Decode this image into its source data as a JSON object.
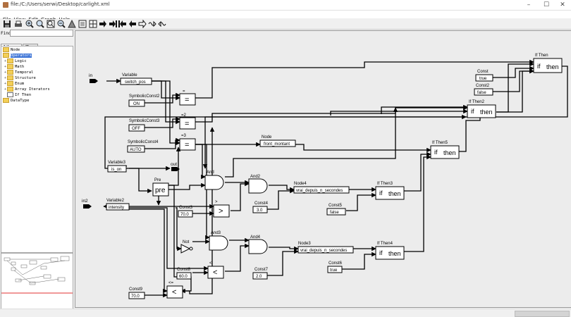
{
  "window": {
    "title": "file:/C:/Users/serwi/Desktop/carlight.xml",
    "minimize": "–",
    "maximize": "☐",
    "close": "✕"
  },
  "menu": [
    "File",
    "View",
    "Edit",
    "Graph",
    "Help"
  ],
  "toolbar": [
    "save-icon",
    "print-icon",
    "zoom-in-icon",
    "zoom-100-icon",
    "zoom-fit-icon",
    "zoom-out-icon",
    "layout-icon",
    "expand-icon",
    "triangle-icon",
    "arrow-right-icon",
    "arrow-right-bar-icon",
    "arrow-left-bar-icon",
    "arrow-left-icon",
    "arrow-outline-right-icon",
    "wave-right-icon",
    "wave-left-icon"
  ],
  "sidebar": {
    "find_label": "Find",
    "find_value": "",
    "tabs": [
      "Library",
      "Tree"
    ],
    "tree": [
      {
        "label": "Node",
        "indent": 0
      },
      {
        "label": "Operators",
        "indent": 0,
        "selected": true
      },
      {
        "label": "Logic",
        "indent": 1
      },
      {
        "label": "Math",
        "indent": 1
      },
      {
        "label": "Temporal",
        "indent": 1
      },
      {
        "label": "Structure",
        "indent": 1
      },
      {
        "label": "Enum",
        "indent": 1
      },
      {
        "label": "Array Iterators",
        "indent": 1
      },
      {
        "label": "If Then",
        "indent": 1
      },
      {
        "label": "DataType",
        "indent": 0
      }
    ]
  },
  "diagram": {
    "inputs": [
      "in",
      "in2"
    ],
    "outputs": [
      "out"
    ],
    "variables": [
      {
        "title": "Variable",
        "value": "switch_pos"
      },
      {
        "title": "Variable3",
        "value": "is_on"
      },
      {
        "title": "Variable2",
        "value": "intensity"
      }
    ],
    "constants": [
      {
        "title": "SymbolicConst2",
        "value": "ON"
      },
      {
        "title": "SymbolicConst3",
        "value": "OFF"
      },
      {
        "title": "SymbolicConst4",
        "value": "AUTO"
      },
      {
        "title": "Const",
        "value": "true"
      },
      {
        "title": "Const2",
        "value": "false"
      },
      {
        "title": "Const3",
        "value": "70.0"
      },
      {
        "title": "Const4",
        "value": "3.0"
      },
      {
        "title": "Const5",
        "value": "false"
      },
      {
        "title": "Const6",
        "value": "true"
      },
      {
        "title": "Const7",
        "value": "2.0"
      },
      {
        "title": "Const8",
        "value": "60.0"
      },
      {
        "title": "Const9",
        "value": "70.0"
      }
    ],
    "compare_blocks": [
      {
        "title": "=",
        "symbol": "="
      },
      {
        "title": "=2",
        "symbol": "="
      },
      {
        "title": "=3",
        "symbol": "="
      },
      {
        "title": ">",
        "symbol": ">"
      },
      {
        "title": "<",
        "symbol": "<"
      },
      {
        "title": "<=",
        "symbol": "<"
      }
    ],
    "nodes": [
      {
        "title": "Node",
        "value": "front_montant"
      },
      {
        "title": "Node4",
        "value": "vrai_depuis_n_secondes"
      },
      {
        "title": "Node3",
        "value": "vrai_depuis_n_secondes"
      }
    ],
    "gates": [
      "And",
      "And2",
      "And3",
      "And4"
    ],
    "not_gate": "Not",
    "pre": {
      "title": "Pre",
      "value": "pre"
    },
    "if_blocks": [
      "If Then",
      "If Then2",
      "If Then3",
      "If Then4",
      "If Then5"
    ],
    "if_label": "if",
    "then_label": "then"
  }
}
